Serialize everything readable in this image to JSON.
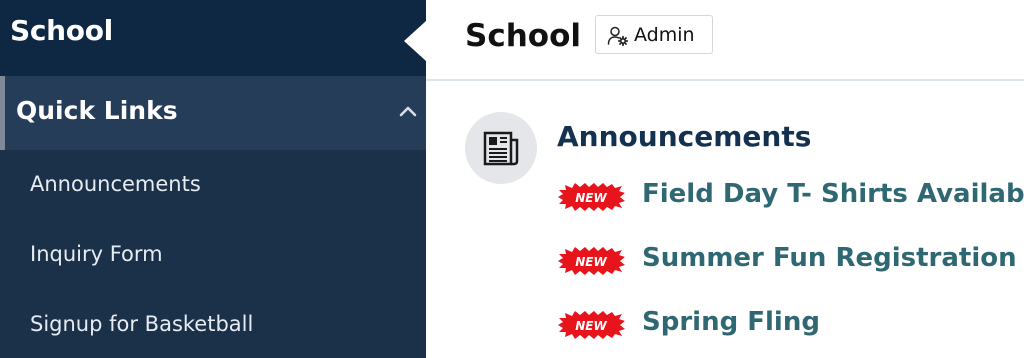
{
  "sidebar": {
    "title": "School",
    "section": {
      "label": "Quick Links",
      "expanded": true
    },
    "links": [
      {
        "label": "Announcements"
      },
      {
        "label": "Inquiry Form"
      },
      {
        "label": "Signup for Basketball"
      }
    ]
  },
  "header": {
    "title": "School",
    "admin_button": {
      "label": "Admin",
      "icon": "user-gear-icon"
    }
  },
  "announcements": {
    "title": "Announcements",
    "icon": "newspaper-icon",
    "badge_text": "NEW",
    "items": [
      {
        "label": "Field Day T- Shirts Available"
      },
      {
        "label": "Summer Fun Registration"
      },
      {
        "label": "Spring Fling"
      }
    ]
  },
  "colors": {
    "sidebar_bg": "#1b3049",
    "sidebar_title_bg": "#0e2742",
    "section_bg": "#253d58",
    "announcement_title": "#14314f",
    "link_color": "#2f6873",
    "badge_red": "#e8141b"
  }
}
